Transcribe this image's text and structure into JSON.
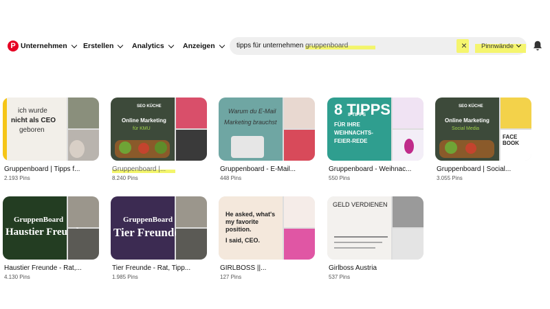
{
  "header": {
    "logo": "P",
    "nav": [
      "Unternehmen",
      "Erstellen",
      "Analytics",
      "Anzeigen"
    ],
    "search_query": "tipps für unternehmen ",
    "search_highlight": "gruppenboard",
    "clear_icon": "×",
    "scope": "Pinnwände",
    "notifications_icon": "bell-icon"
  },
  "boards": [
    {
      "title": "Gruppenboard | Tipps f...",
      "pins": "2.193 Pins",
      "thumb_text": [
        "ich wurde",
        "nicht als CEO",
        "geboren"
      ]
    },
    {
      "title": "Gruppenboard |...",
      "pins": "8.240 Pins",
      "thumb_text": [
        "SEO KÜCHE",
        "Online Marketing",
        "für KMU"
      ],
      "highlighted": true
    },
    {
      "title": "Gruppenboard - E-Mail...",
      "pins": "448 Pins",
      "thumb_text": [
        "Warum du E-Mail",
        "Marketing brauchst"
      ]
    },
    {
      "title": "Gruppenboard - Weihnac...",
      "pins": "550 Pins",
      "thumb_text": [
        "8 TIPPS",
        "FÜR IHRE",
        "WEIHNACHTS-",
        "FEIER-REDE"
      ]
    },
    {
      "title": "Gruppenboard | Social...",
      "pins": "3.055 Pins",
      "thumb_text": [
        "SEO KÜCHE",
        "Online Marketing",
        "Social Media",
        "FACE BOOK"
      ]
    },
    {
      "title": "Haustier Freunde - Rat,...",
      "pins": "4.130 Pins",
      "thumb_text": [
        "GruppenBoard",
        "Haustier Freunde"
      ]
    },
    {
      "title": "Tier Freunde - Rat, Tipp...",
      "pins": "1.985 Pins",
      "thumb_text": [
        "GruppenBoard",
        "Tier Freunde"
      ]
    },
    {
      "title": "GIRLBOSS ||...",
      "pins": "127 Pins",
      "thumb_text": [
        "He asked, what's",
        "my favorite",
        "position.",
        "I said, CEO."
      ]
    },
    {
      "title": "Girlboss Austria",
      "pins": "537 Pins",
      "thumb_text": [
        "GELD VERDIENEN"
      ]
    }
  ]
}
